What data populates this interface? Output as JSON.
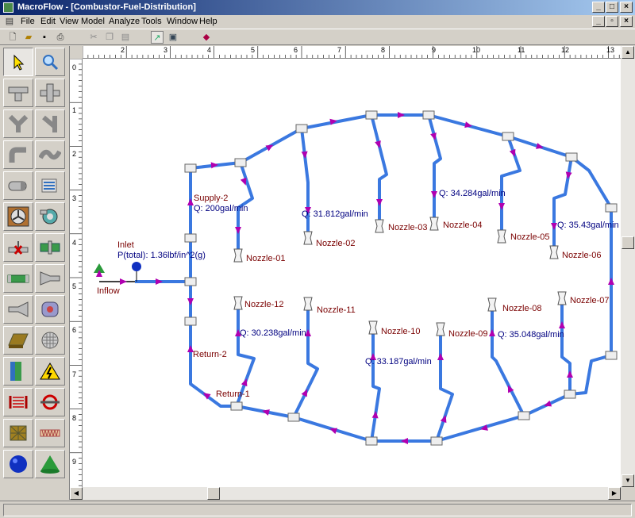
{
  "window": {
    "title": "MacroFlow - [Combustor-Fuel-Distribution]"
  },
  "menu": [
    "File",
    "Edit",
    "View",
    "Model",
    "Analyze",
    "Tools",
    "Window",
    "Help"
  ],
  "toolbar": {
    "items": [
      "new-icon",
      "open-icon",
      "save-icon",
      "print-icon",
      "cut-icon",
      "copy-icon",
      "paste-icon",
      "select-chart-icon",
      "picture-icon",
      "book-icon"
    ]
  },
  "palette": {
    "items": [
      "pointer-tool",
      "zoom-tool",
      "tee-tool",
      "cross-tool",
      "wye-tool",
      "lateral-tool",
      "elbow-tool",
      "bend-tool",
      "filter-tool",
      "heat-exchanger-tool",
      "fan-tool",
      "pump-tool",
      "valve-tool",
      "orifice-tool",
      "pipe-tool",
      "nozzle-tool",
      "diffuser-tool",
      "compressor-tool",
      "turbine-tool",
      "screen-tool",
      "wall-tool",
      "heater-tool",
      "coil-tool",
      "rotor-tool",
      "packed-bed-tool",
      "spring-tool",
      "sphere-tool",
      "cone-tool"
    ]
  },
  "ruler": {
    "h": [
      "2",
      "3",
      "4",
      "5",
      "6",
      "7",
      "8",
      "9",
      "10",
      "11",
      "12",
      "13"
    ],
    "v": [
      "0",
      "1",
      "2",
      "3",
      "4",
      "5",
      "6",
      "7",
      "8",
      "9"
    ]
  },
  "diagram": {
    "labels": {
      "inlet": "Inlet",
      "inlet_p": "P(total): 1.36lbf/in^2(g)",
      "inflow": "Inflow",
      "supply": "Supply-2",
      "supply_q": "Q: 200gal/min",
      "return2": "Return-2",
      "return1": "Return-1"
    },
    "nozzles": [
      {
        "name": "Nozzle-01",
        "q": ""
      },
      {
        "name": "Nozzle-02",
        "q": "Q: 31.812gal/min"
      },
      {
        "name": "Nozzle-03",
        "q": ""
      },
      {
        "name": "Nozzle-04",
        "q": "Q: 34.284gal/min"
      },
      {
        "name": "Nozzle-05",
        "q": ""
      },
      {
        "name": "Nozzle-06",
        "q": "Q: 35.43gal/min"
      },
      {
        "name": "Nozzle-07",
        "q": ""
      },
      {
        "name": "Nozzle-08",
        "q": "Q: 35.048gal/min"
      },
      {
        "name": "Nozzle-09",
        "q": ""
      },
      {
        "name": "Nozzle-10",
        "q": "Q: 33.187gal/min"
      },
      {
        "name": "Nozzle-11",
        "q": ""
      },
      {
        "name": "Nozzle-12",
        "q": "Q: 30.238gal/min"
      }
    ]
  },
  "colors": {
    "pipe": "#3a78e0",
    "arrow": "#b000b0",
    "name": "#7a0000",
    "flow": "#000080"
  }
}
